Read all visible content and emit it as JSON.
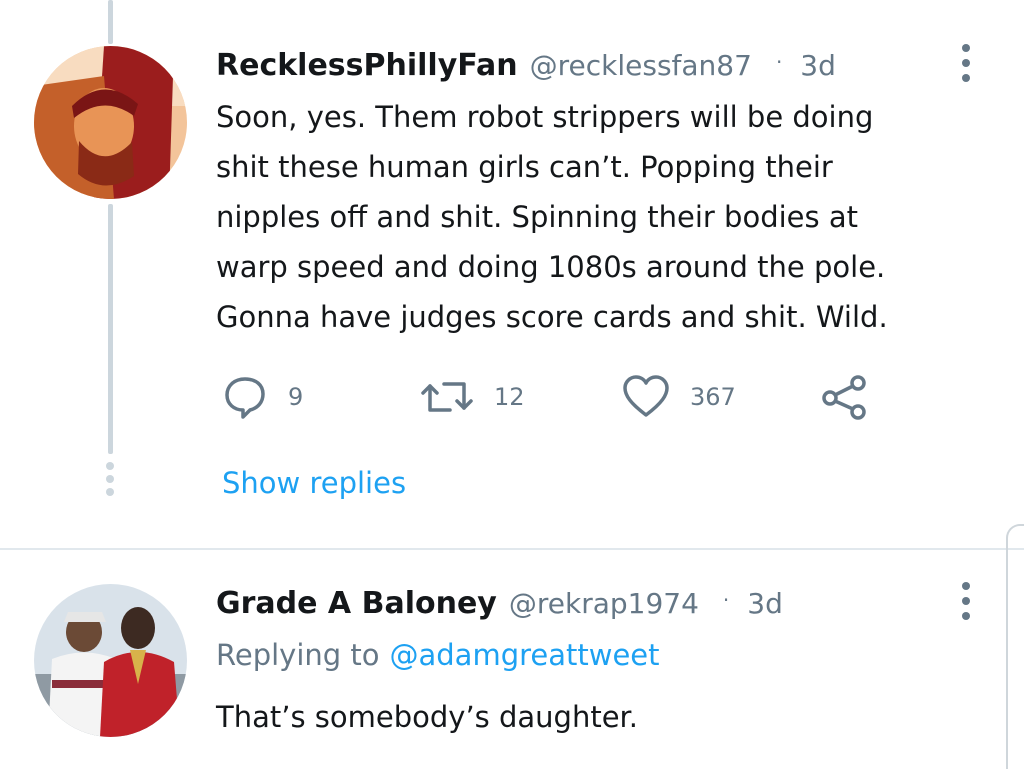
{
  "tweets": [
    {
      "name": "RecklessPhillyFan",
      "handle": "@recklessfan87",
      "separator": "·",
      "time": "3d",
      "avatar_icon": "profile-photo",
      "lines": [
        "Soon, yes. Them robot strippers will be doing",
        "shit these human girls can’t. Popping their",
        "nipples off and shit. Spinning their bodies at",
        "warp speed and doing 1080s around the pole.",
        "Gonna have judges score cards and shit. Wild."
      ],
      "actions": {
        "replies": "9",
        "retweets": "12",
        "likes": "367"
      },
      "show_replies": "Show replies"
    },
    {
      "name": "Grade A Baloney",
      "handle": "@rekrap1974",
      "separator": "·",
      "time": "3d",
      "avatar_icon": "profile-photo",
      "replying_label": "Replying to",
      "replying_to": "@adamgreattweet",
      "text": "That’s somebody’s daughter."
    }
  ],
  "colors": {
    "accent": "#1da1f2",
    "muted": "#657786",
    "thread_line": "#ccd6dd"
  }
}
